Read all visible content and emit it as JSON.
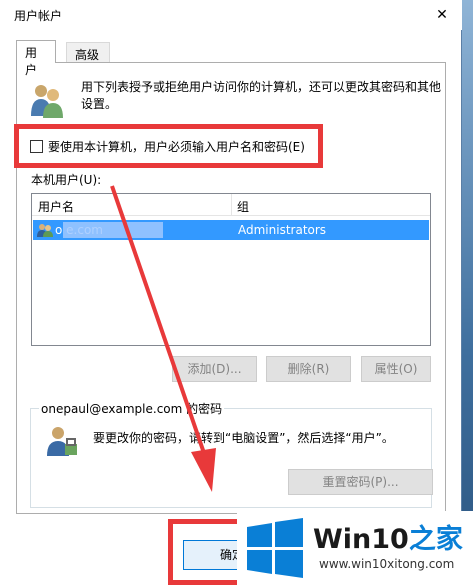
{
  "window": {
    "title": "用户帐户",
    "close_glyph": "✕"
  },
  "tabs": [
    {
      "label": "用户",
      "active": true
    },
    {
      "label": "高级",
      "active": false
    }
  ],
  "description": "用下列表授予或拒绝用户访问你的计算机，还可以更改其密码和其他设置。",
  "require_login": {
    "label": "要使用本计算机，用户必须输入用户名和密码(E)",
    "checked": false
  },
  "users_section_label": "本机用户(U):",
  "table": {
    "columns": [
      "用户名",
      "组"
    ],
    "rows": [
      {
        "name": "o                         e.com",
        "group": "Administrators",
        "selected": true
      }
    ]
  },
  "buttons": {
    "add": "添加(D)...",
    "remove": "删除(R)",
    "properties": "属性(O)",
    "reset_password": "重置密码(P)...",
    "ok": "确定"
  },
  "password_group": {
    "legend": "onepaul@example.com 的密码",
    "description": "要更改你的密码，请转到“电脑设置”，然后选择“用户”。"
  },
  "watermark": {
    "brand_part1": "Win10",
    "brand_part2": "之家",
    "url": "www.win10xitong.com"
  },
  "colors": {
    "selection": "#3399ff",
    "highlight_red": "#e8393a",
    "windows_blue": "#0a7fd6"
  }
}
